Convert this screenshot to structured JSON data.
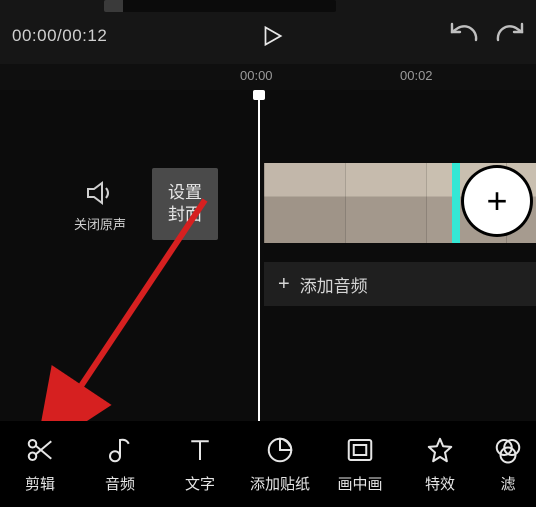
{
  "player": {
    "current_time": "00:00",
    "total_time": "00:12",
    "time_display": "00:00/00:12"
  },
  "ruler": {
    "tick1": "00:00",
    "tick2": "00:02"
  },
  "controls": {
    "mute_label": "关闭原声",
    "cover_label": "设置\n封面",
    "add_audio_label": "添加音频",
    "add_clip_symbol": "+",
    "add_audio_symbol": "+"
  },
  "toolbar": {
    "items": [
      {
        "icon": "scissors-icon",
        "label": "剪辑"
      },
      {
        "icon": "music-note-icon",
        "label": "音频"
      },
      {
        "icon": "text-icon",
        "label": "文字"
      },
      {
        "icon": "sticker-icon",
        "label": "添加贴纸"
      },
      {
        "icon": "pip-icon",
        "label": "画中画"
      },
      {
        "icon": "star-icon",
        "label": "特效"
      },
      {
        "icon": "filter-icon",
        "label": "滤"
      }
    ]
  },
  "colors": {
    "bg": "#111111",
    "accent_arrow": "#d62020",
    "track_teal": "#34e7d5"
  }
}
